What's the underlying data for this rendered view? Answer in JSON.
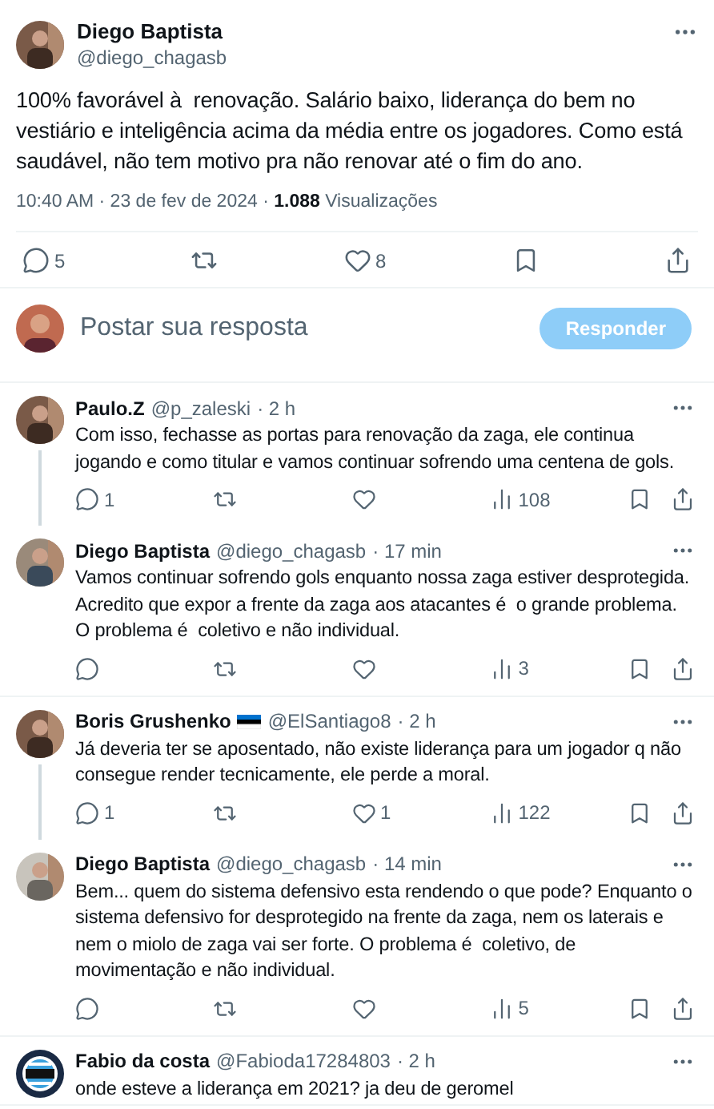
{
  "tweet": {
    "name": "Diego Baptista",
    "handle": "@diego_chagasb",
    "text": "100% favorável à  renovação. Salário baixo, liderança do bem no vestiário e inteligência acima da média entre os jogadores. Como está saudável, não tem motivo pra não renovar até o fim do ano.",
    "time": "10:40 AM · 23 de fev de 2024 · ",
    "views": "1.088",
    "views_label": " Visualizações",
    "reply_count": "5",
    "like_count": "8"
  },
  "composer": {
    "placeholder": "Postar sua resposta",
    "button": "Responder",
    "disabled": true
  },
  "replies": [
    {
      "name": "Paulo.Z",
      "handle": "@p_zaleski",
      "time": "· 2 h",
      "flag": false,
      "threaded": true,
      "text": "Com isso, fechasse as portas para renovação da zaga, ele continua jogando e como titular e vamos continuar sofrendo uma centena de gols.",
      "reply_count": "1",
      "views": "108"
    },
    {
      "name": "Diego Baptista",
      "handle": "@diego_chagasb",
      "time": "· 17 min",
      "flag": false,
      "threaded": false,
      "text": "Vamos continuar sofrendo gols enquanto nossa zaga estiver desprotegida. Acredito que expor a frente da zaga aos atacantes é  o grande problema. O problema é  coletivo e não individual.",
      "views": "3"
    },
    {
      "name": "Boris Grushenko",
      "handle": "@ElSantiago8",
      "time": "· 2 h",
      "flag": true,
      "threaded": true,
      "text": "Já deveria ter se aposentado, não existe liderança para um jogador q não consegue render tecnicamente, ele perde a moral.",
      "reply_count": "1",
      "like_count": "1",
      "views": "122"
    },
    {
      "name": "Diego Baptista",
      "handle": "@diego_chagasb",
      "time": "· 14 min",
      "flag": false,
      "threaded": false,
      "text": "Bem... quem do sistema defensivo esta rendendo o que pode? Enquanto o sistema defensivo for desprotegido na frente da zaga, nem os laterais e nem o miolo de zaga vai ser forte. O problema é  coletivo, de movimentação e não individual.",
      "views": "5"
    },
    {
      "name": "Fabio da costa",
      "handle": "@Fabioda17284803",
      "time": "· 2 h",
      "flag": false,
      "threaded": false,
      "text": "onde esteve a liderança em 2021? ja deu de geromel"
    }
  ]
}
